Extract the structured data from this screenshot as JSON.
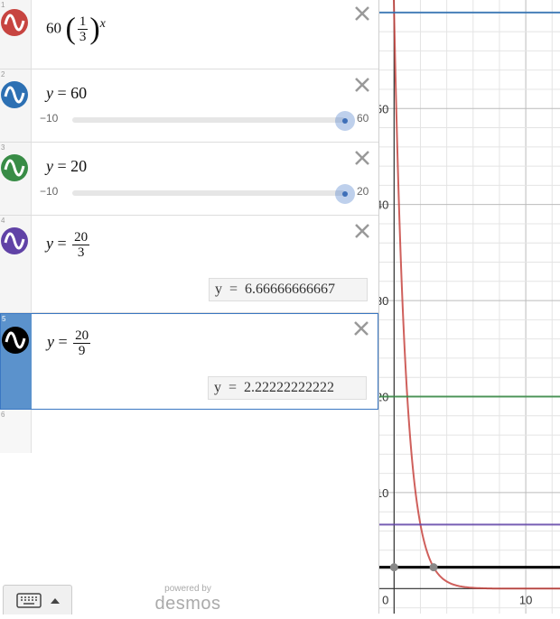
{
  "expressions": [
    {
      "index": "1",
      "color": "#c74440",
      "content": "60(1/3)^x"
    },
    {
      "index": "2",
      "color": "#2d70b3",
      "lhs": "y",
      "rhs": "60",
      "slider": {
        "min": "−10",
        "max": "60",
        "value": 60
      }
    },
    {
      "index": "3",
      "color": "#388c46",
      "lhs": "y",
      "rhs": "20",
      "slider": {
        "min": "−10",
        "max": "20",
        "value": 20
      }
    },
    {
      "index": "4",
      "color": "#6042a6",
      "lhs": "y",
      "frac_num": "20",
      "frac_den": "3",
      "eval": "y  =  6.66666666667"
    },
    {
      "index": "5",
      "color": "#000000",
      "lhs": "y",
      "frac_num": "20",
      "frac_den": "9",
      "eval": "y  =  2.22222222222",
      "selected": true
    },
    {
      "index": "6"
    }
  ],
  "footer": {
    "powered_by": "powered by",
    "brand": "desmos"
  },
  "graph": {
    "x_min": -1.12,
    "x_max": 12.6,
    "y_min": -2.6,
    "y_max": 61.3,
    "x_ticks": [
      {
        "value": 0,
        "label": "0"
      },
      {
        "value": 10,
        "label": "10"
      }
    ],
    "y_ticks": [
      {
        "value": 10,
        "label": "10"
      },
      {
        "value": 20,
        "label": "20"
      },
      {
        "value": 30,
        "label": "30"
      },
      {
        "value": 40,
        "label": "40"
      },
      {
        "value": 50,
        "label": "50"
      }
    ],
    "curves": [
      {
        "kind": "exp",
        "a": 60,
        "b": 0.3333333,
        "color": "#c74440"
      },
      {
        "kind": "hline",
        "y": 60,
        "color": "#2d70b3"
      },
      {
        "kind": "hline",
        "y": 20,
        "color": "#388c46"
      },
      {
        "kind": "hline",
        "y": 6.6667,
        "color": "#6042a6"
      },
      {
        "kind": "hline",
        "y": 2.2222,
        "color": "#000000"
      }
    ],
    "points": [
      {
        "x": 0,
        "y": 2.2222
      },
      {
        "x": 3,
        "y": 2.2222
      }
    ]
  }
}
